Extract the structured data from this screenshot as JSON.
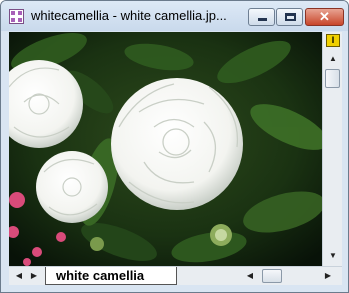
{
  "window": {
    "title": "whitecamellia - white camellia.jp..."
  },
  "titlebar": {
    "minimize_icon": "minimize-icon",
    "maximize_icon": "maximize-icon",
    "close_icon": "close-icon",
    "close_glyph": "✕"
  },
  "image": {
    "subject_icon": "camellia-photo"
  },
  "scroll": {
    "split_button_glyph": "I",
    "up_arrow": "▲",
    "down_arrow": "▼",
    "left_arrow": "◀",
    "right_arrow": "▶"
  },
  "sheet": {
    "tab_label": "white camellia"
  },
  "colors": {
    "title_bg": "#c9d9ec",
    "close_red": "#c8452a",
    "split_yellow": "#f0d000"
  }
}
